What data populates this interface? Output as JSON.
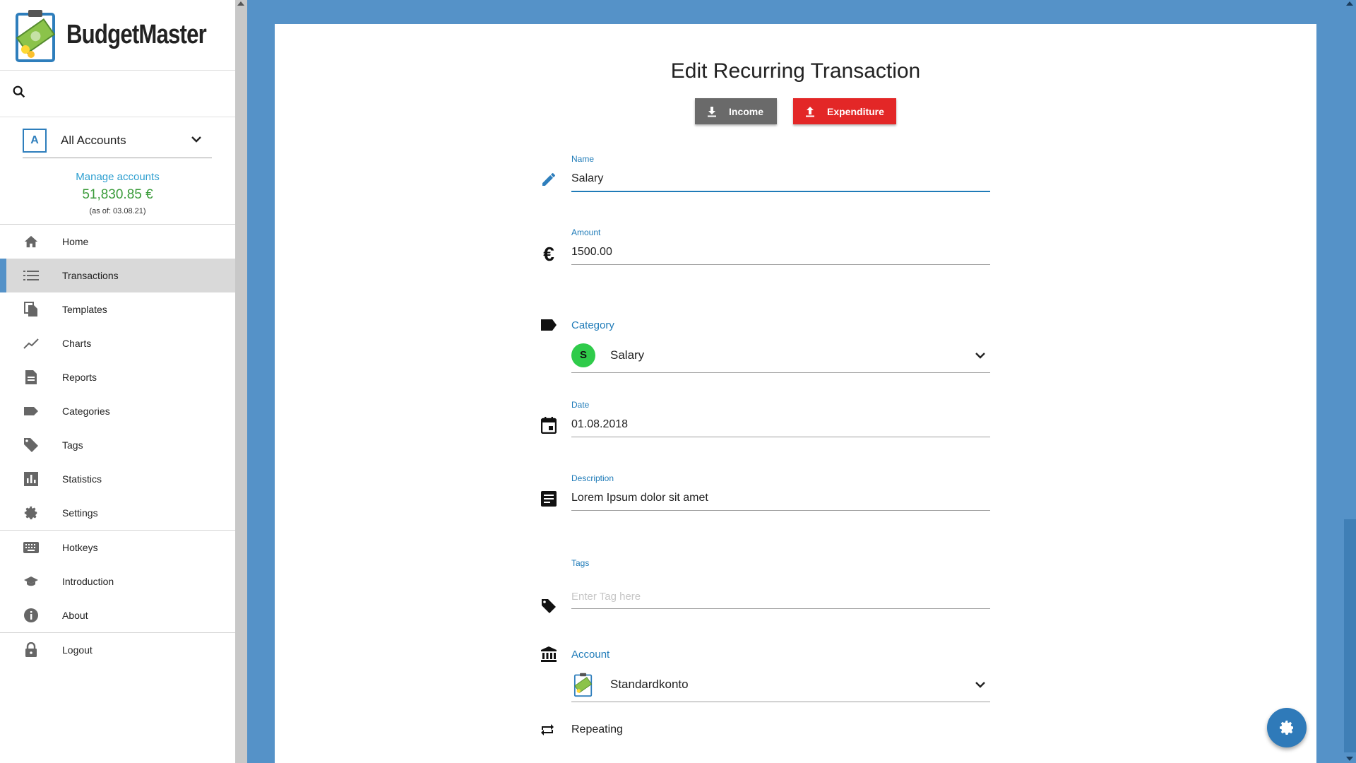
{
  "app": {
    "name": "BudgetMaster"
  },
  "sidebar": {
    "search_placeholder": "",
    "account": {
      "badge": "A",
      "name": "All Accounts"
    },
    "manage_accounts": "Manage accounts",
    "balance": "51,830.85 €",
    "as_of": "(as of: 03.08.21)",
    "items": [
      {
        "label": "Home",
        "icon": "home-icon"
      },
      {
        "label": "Transactions",
        "icon": "list-icon",
        "active": true
      },
      {
        "label": "Templates",
        "icon": "copy-icon"
      },
      {
        "label": "Charts",
        "icon": "chart-line-icon"
      },
      {
        "label": "Reports",
        "icon": "document-icon"
      },
      {
        "label": "Categories",
        "icon": "label-icon"
      },
      {
        "label": "Tags",
        "icon": "tag-icon"
      },
      {
        "label": "Statistics",
        "icon": "bar-chart-icon"
      },
      {
        "label": "Settings",
        "icon": "gear-icon"
      },
      {
        "label": "Hotkeys",
        "icon": "keyboard-icon"
      },
      {
        "label": "Introduction",
        "icon": "school-icon"
      },
      {
        "label": "About",
        "icon": "info-icon"
      },
      {
        "label": "Logout",
        "icon": "lock-icon"
      }
    ]
  },
  "main": {
    "title": "Edit Recurring Transaction",
    "income_label": "Income",
    "expenditure_label": "Expenditure",
    "name": {
      "label": "Name",
      "value": "Salary"
    },
    "amount": {
      "label": "Amount",
      "value": "1500.00"
    },
    "category": {
      "label": "Category",
      "badge": "S",
      "value": "Salary"
    },
    "date": {
      "label": "Date",
      "value": "01.08.2018"
    },
    "description": {
      "label": "Description",
      "value": "Lorem Ipsum dolor sit amet"
    },
    "tags": {
      "label": "Tags",
      "placeholder": "Enter Tag here"
    },
    "account": {
      "label": "Account",
      "value": "Standardkonto"
    },
    "repeating_label": "Repeating"
  },
  "colors": {
    "background": "#5592c8",
    "accent": "#1f7bb8",
    "expenditure": "#e32727",
    "income": "#6a6a6a",
    "balance": "#3a9b3a",
    "category_badge": "#2fcb4a"
  }
}
